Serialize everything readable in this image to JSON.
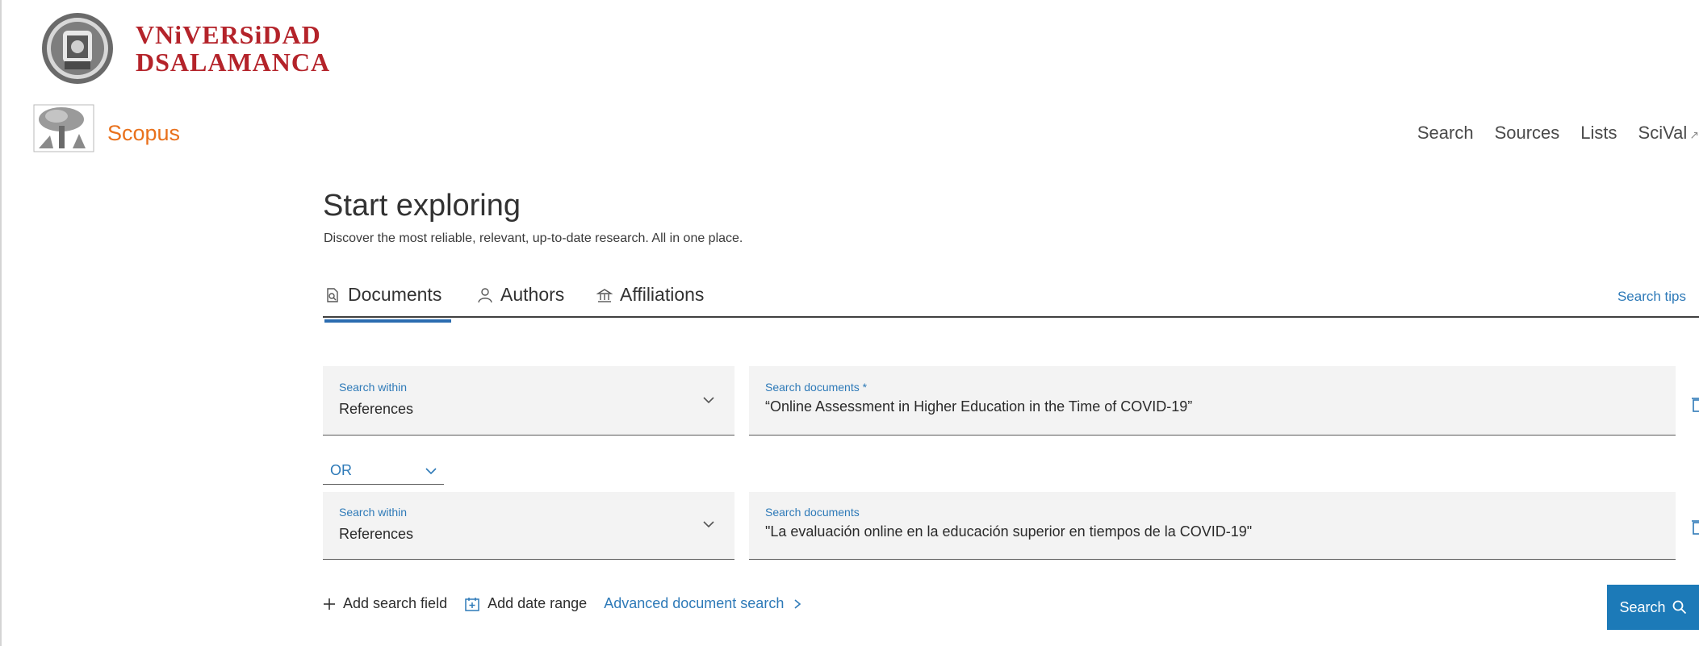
{
  "institution": {
    "name_line1": "VNiVERSiDAD",
    "name_line2": "DSALAMANCA"
  },
  "brand": {
    "name": "Scopus",
    "color": "#e9711c"
  },
  "nav": {
    "items": [
      "Search",
      "Sources",
      "Lists",
      "SciVal"
    ],
    "external_icon": "↗"
  },
  "hero": {
    "title": "Start exploring",
    "subtitle": "Discover the most reliable, relevant, up-to-date research. All in one place."
  },
  "tabs": [
    {
      "label": "Documents",
      "icon": "document-search-icon",
      "active": true
    },
    {
      "label": "Authors",
      "icon": "person-icon",
      "active": false
    },
    {
      "label": "Affiliations",
      "icon": "institution-icon",
      "active": false
    }
  ],
  "search_tips": "Search tips",
  "rows": [
    {
      "within_label": "Search within",
      "within_value": "References",
      "query_label": "Search documents *",
      "query_value": "“Online Assessment in Higher Education in the Time of COVID-19”"
    },
    {
      "within_label": "Search within",
      "within_value": "References",
      "query_label": "Search documents",
      "query_value": "\"La evaluación online en la educación superior en tiempos de la COVID-19\""
    }
  ],
  "operator": "OR",
  "actions": {
    "add_field": "Add search field",
    "add_date": "Add date range",
    "advanced": "Advanced document search"
  },
  "search_button": "Search",
  "colors": {
    "accent": "#2e7ab8",
    "button": "#1c7ab8",
    "university_red": "#b4232a"
  }
}
